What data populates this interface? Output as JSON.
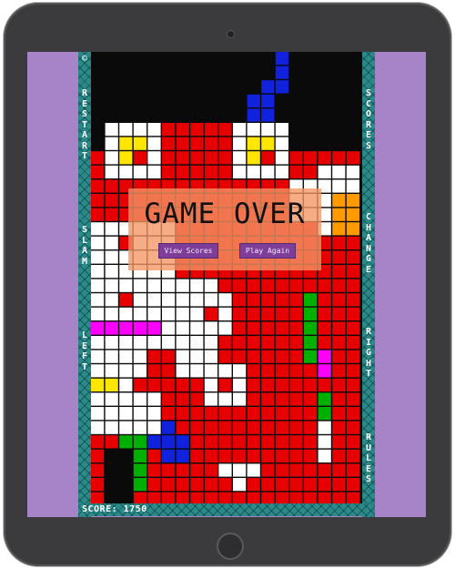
{
  "game": {
    "title": "GAME OVER",
    "score_text": "SCORE: 1750",
    "copyright_glyph": "©"
  },
  "buttons": {
    "view_scores": "View Scores",
    "play_again": "Play Again"
  },
  "left_controls": [
    "RESTART",
    "SLAM",
    "LEFT"
  ],
  "right_controls": [
    "SCORES",
    "CHANGE",
    "RIGHT",
    "RULES"
  ],
  "colors": {
    "frame": "#2a8a8a",
    "screen_bg": "#a784c8",
    "overlay": "#f49664",
    "button": "#7d3d98"
  }
}
